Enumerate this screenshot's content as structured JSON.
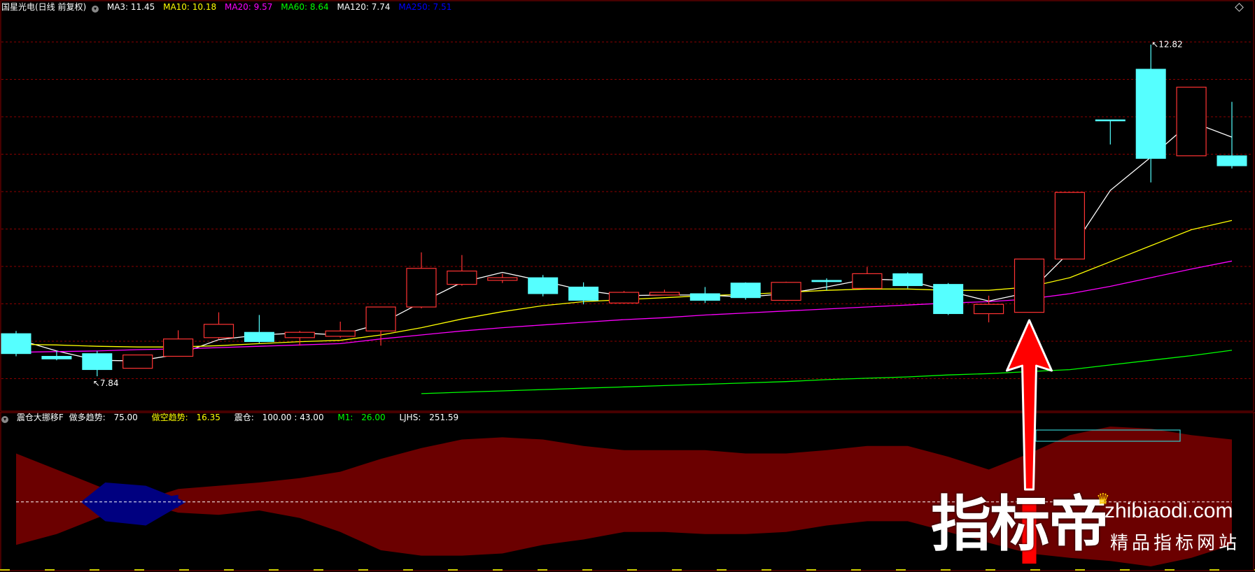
{
  "top_header": {
    "stock": "国星光电(日线 前复权)",
    "ma": [
      {
        "label": "MA3: 11.45",
        "color": "#ffffff"
      },
      {
        "label": "MA10: 10.18",
        "color": "#ffff00"
      },
      {
        "label": "MA20: 9.57",
        "color": "#ff00ff"
      },
      {
        "label": "MA60: 8.64",
        "color": "#00ff00"
      },
      {
        "label": "MA120: 7.74",
        "color": "#ffffff"
      },
      {
        "label": "MA250: 7.51",
        "color": "#0000ff"
      }
    ]
  },
  "bottom_header": {
    "indicator": "震仓大挪移F",
    "items": [
      {
        "label": "做多趋势:",
        "value": "75.00",
        "label_color": "#ffffff",
        "value_color": "#ffffff"
      },
      {
        "label": "做空趋势:",
        "value": "16.35",
        "label_color": "#ffff00",
        "value_color": "#ffff00"
      },
      {
        "label": "震仓:",
        "value": "100.00 : 43.00",
        "label_color": "#ffffff",
        "value_color": "#ffffff"
      },
      {
        "label": "M1:",
        "value": "26.00",
        "label_color": "#00ff00",
        "value_color": "#00ff00"
      },
      {
        "label": "LJHS:",
        "value": "251.59",
        "label_color": "#ffffff",
        "value_color": "#ffffff"
      }
    ]
  },
  "colors": {
    "up": "#ff3333",
    "down": "#55ffff",
    "grid": "#8b0000",
    "band_red": "#6b0000",
    "band_blue": "#000080"
  },
  "chart_data": {
    "type": "candlestick",
    "ylim": [
      7.4,
      13.3
    ],
    "high_marker": {
      "index": 28,
      "value": 12.82,
      "label": "12.82"
    },
    "low_marker": {
      "index": 2,
      "value": 7.84,
      "label": "7.84"
    },
    "candles": [
      {
        "o": 8.48,
        "c": 8.18,
        "h": 8.52,
        "l": 8.14
      },
      {
        "o": 8.14,
        "c": 8.1,
        "h": 8.22,
        "l": 8.08
      },
      {
        "o": 8.18,
        "c": 7.94,
        "h": 8.22,
        "l": 7.84
      },
      {
        "o": 7.96,
        "c": 8.16,
        "h": 8.16,
        "l": 7.96
      },
      {
        "o": 8.14,
        "c": 8.4,
        "h": 8.53,
        "l": 8.14
      },
      {
        "o": 8.42,
        "c": 8.62,
        "h": 8.8,
        "l": 8.4
      },
      {
        "o": 8.5,
        "c": 8.36,
        "h": 8.76,
        "l": 8.34
      },
      {
        "o": 8.42,
        "c": 8.5,
        "h": 8.52,
        "l": 8.3
      },
      {
        "o": 8.44,
        "c": 8.52,
        "h": 8.66,
        "l": 8.42
      },
      {
        "o": 8.52,
        "c": 8.88,
        "h": 8.88,
        "l": 8.3
      },
      {
        "o": 8.88,
        "c": 9.46,
        "h": 9.7,
        "l": 8.86
      },
      {
        "o": 9.22,
        "c": 9.42,
        "h": 9.66,
        "l": 9.2
      },
      {
        "o": 9.28,
        "c": 9.32,
        "h": 9.38,
        "l": 9.24
      },
      {
        "o": 9.32,
        "c": 9.08,
        "h": 9.36,
        "l": 9.04
      },
      {
        "o": 9.18,
        "c": 8.98,
        "h": 9.25,
        "l": 8.92
      },
      {
        "o": 8.94,
        "c": 9.1,
        "h": 9.12,
        "l": 8.94
      },
      {
        "o": 9.06,
        "c": 9.1,
        "h": 9.14,
        "l": 9.06
      },
      {
        "o": 9.08,
        "c": 8.98,
        "h": 9.18,
        "l": 8.94
      },
      {
        "o": 9.24,
        "c": 9.02,
        "h": 9.25,
        "l": 8.99
      },
      {
        "o": 8.98,
        "c": 9.25,
        "h": 9.26,
        "l": 8.97
      },
      {
        "o": 9.28,
        "c": 9.26,
        "h": 9.31,
        "l": 9.13
      },
      {
        "o": 9.16,
        "c": 9.38,
        "h": 9.48,
        "l": 9.16
      },
      {
        "o": 9.38,
        "c": 9.2,
        "h": 9.4,
        "l": 9.16
      },
      {
        "o": 9.22,
        "c": 8.78,
        "h": 9.24,
        "l": 8.76
      },
      {
        "o": 8.78,
        "c": 8.92,
        "h": 9.05,
        "l": 8.65
      },
      {
        "o": 8.8,
        "c": 9.6,
        "h": 9.6,
        "l": 8.8
      },
      {
        "o": 9.6,
        "c": 10.6,
        "h": 10.6,
        "l": 9.6
      },
      {
        "o": 11.69,
        "c": 11.69,
        "h": 11.69,
        "l": 11.32
      },
      {
        "o": 12.45,
        "c": 11.11,
        "h": 12.82,
        "l": 10.75
      },
      {
        "o": 11.15,
        "c": 12.18,
        "h": 12.18,
        "l": 11.15
      },
      {
        "o": 11.15,
        "c": 11.0,
        "h": 11.96,
        "l": 10.96
      }
    ],
    "series": [
      {
        "name": "MA3",
        "color": "#ffffff",
        "start": 0,
        "values": [
          8.4,
          8.22,
          8.08,
          8.07,
          8.17,
          8.39,
          8.46,
          8.49,
          8.46,
          8.63,
          8.95,
          9.25,
          9.4,
          9.27,
          9.13,
          9.05,
          9.06,
          9.06,
          9.03,
          9.08,
          9.18,
          9.3,
          9.28,
          9.12,
          8.97,
          9.1,
          9.71,
          10.63,
          11.13,
          11.66,
          11.43
        ]
      },
      {
        "name": "MA10",
        "color": "#ffff00",
        "start": 0,
        "values": [
          8.32,
          8.31,
          8.29,
          8.28,
          8.28,
          8.3,
          8.33,
          8.36,
          8.38,
          8.46,
          8.57,
          8.7,
          8.81,
          8.9,
          8.96,
          8.99,
          9.02,
          9.05,
          9.07,
          9.1,
          9.13,
          9.15,
          9.15,
          9.13,
          9.13,
          9.18,
          9.32,
          9.56,
          9.8,
          10.04,
          10.18
        ]
      },
      {
        "name": "MA20",
        "color": "#ff00ff",
        "start": 0,
        "values": [
          8.2,
          8.21,
          8.22,
          8.24,
          8.25,
          8.27,
          8.29,
          8.31,
          8.33,
          8.4,
          8.46,
          8.52,
          8.57,
          8.61,
          8.65,
          8.69,
          8.72,
          8.76,
          8.79,
          8.82,
          8.85,
          8.88,
          8.91,
          8.94,
          8.96,
          9.0,
          9.08,
          9.19,
          9.32,
          9.45,
          9.57
        ]
      },
      {
        "name": "MA60",
        "color": "#00ff00",
        "start": 10,
        "values": [
          7.58,
          7.6,
          7.62,
          7.64,
          7.66,
          7.68,
          7.7,
          7.72,
          7.74,
          7.76,
          7.79,
          7.81,
          7.83,
          7.86,
          7.88,
          7.91,
          7.94,
          8.01,
          8.08,
          8.15,
          8.23
        ]
      }
    ],
    "oscillator": {
      "ylim": [
        -60,
        70
      ],
      "zero_label": "",
      "upper": [
        45,
        30,
        15,
        0,
        12,
        15,
        18,
        22,
        28,
        40,
        50,
        58,
        60,
        58,
        52,
        48,
        48,
        48,
        45,
        45,
        48,
        52,
        52,
        42,
        30,
        45,
        62,
        70,
        68,
        62,
        58
      ],
      "lower": [
        -40,
        -30,
        -15,
        0,
        -10,
        -12,
        -8,
        -15,
        -28,
        -45,
        -50,
        -50,
        -48,
        -40,
        -35,
        -28,
        -28,
        -30,
        -30,
        -28,
        -22,
        -18,
        -18,
        -28,
        -38,
        -48,
        -52,
        -55,
        -60,
        -52,
        -40
      ],
      "blue_range": [
        2,
        4
      ]
    },
    "signal": {
      "index": 25,
      "label": ""
    }
  },
  "brand": {
    "cn": "指标帝",
    "url": "zhibiaodi.com",
    "sub": "精品指标网站"
  }
}
